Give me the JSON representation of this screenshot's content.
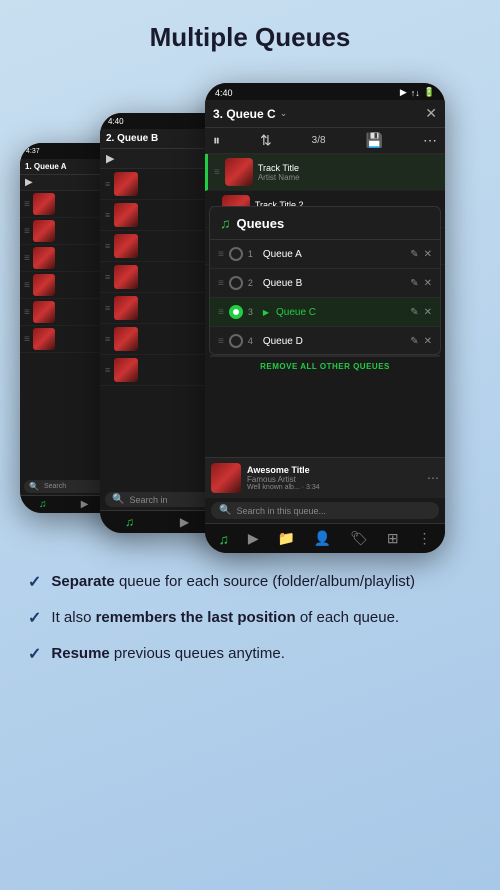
{
  "page": {
    "title": "Multiple Queues",
    "background_color": "#b8d4e8"
  },
  "phone1": {
    "status_time": "4:37",
    "queue_name": "1. Queue A",
    "tracks": [
      {
        "id": 1
      },
      {
        "id": 2
      },
      {
        "id": 3
      },
      {
        "id": 4
      },
      {
        "id": 5
      },
      {
        "id": 6
      }
    ],
    "search_placeholder": "Search"
  },
  "phone2": {
    "status_time": "4:40",
    "queue_name": "2. Queue B",
    "tracks": [
      {
        "id": 1
      },
      {
        "id": 2
      },
      {
        "id": 3
      },
      {
        "id": 4
      },
      {
        "id": 5
      },
      {
        "id": 6
      },
      {
        "id": 7
      }
    ],
    "search_placeholder": "Search in"
  },
  "phone3": {
    "status_time": "4:40",
    "queue_name": "3. Queue C",
    "track_count": "3/8",
    "tracks": [
      {
        "id": 1
      },
      {
        "id": 2
      },
      {
        "id": 3
      },
      {
        "id": 4
      },
      {
        "id": 5
      }
    ],
    "search_placeholder": "Search in this queue...",
    "queues_dropdown": {
      "header_icon": "♫",
      "header_label": "Queues",
      "items": [
        {
          "number": 1,
          "name": "Queue A",
          "active": false
        },
        {
          "number": 2,
          "name": "Queue B",
          "active": false
        },
        {
          "number": 3,
          "name": "Queue C",
          "active": true,
          "playing": true
        },
        {
          "number": 4,
          "name": "Queue D",
          "active": false
        }
      ],
      "remove_all_label": "REMOVE ALL OTHER QUEUES"
    },
    "now_playing": {
      "title": "Awesome Title",
      "artist": "Famous Artist",
      "time": "Well known alb... · 3:34"
    }
  },
  "features": [
    {
      "bold_part": "Separate",
      "rest": " queue for each source (folder/album/playlist)"
    },
    {
      "prefix": "It also ",
      "bold_part": "remembers the last position",
      "rest": " of each queue."
    },
    {
      "bold_part": "Resume",
      "rest": " previous queues anytime."
    }
  ],
  "icons": {
    "play": "▶",
    "pause": "⏸",
    "menu": "≡",
    "sort": "⇅",
    "save": "💾",
    "more_vert": "⋯",
    "close": "✕",
    "chevron": "⌄",
    "search": "🔍",
    "edit": "✎",
    "delete": "✕",
    "drag": "≡",
    "check": "✓",
    "queue": "♫",
    "folder": "📁",
    "person": "👤",
    "tag": "🏷",
    "grid": "⊞",
    "dots": "⋮"
  }
}
